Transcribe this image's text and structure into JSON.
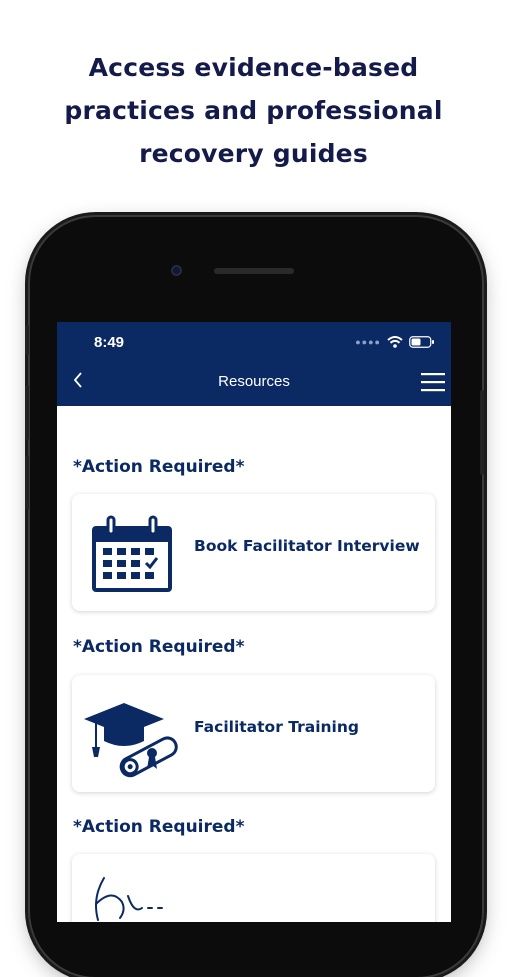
{
  "headline": {
    "line1": "Access evidence-based",
    "line2": "practices and professional",
    "line3": "recovery guides"
  },
  "status_bar": {
    "time": "8:49"
  },
  "app_bar": {
    "title": "Resources"
  },
  "sections": [
    {
      "label": "*Action Required*",
      "card_label": "Book Facilitator Interview",
      "icon": "calendar-icon"
    },
    {
      "label": "*Action Required*",
      "card_label": "Facilitator Training",
      "icon": "graduation-cap-diploma-icon"
    },
    {
      "label": "*Action Required*",
      "card_label": "",
      "icon": "signature-icon"
    }
  ],
  "colors": {
    "navy": "#0b2a63",
    "headline": "#141a4a",
    "background": "#ffffff"
  }
}
